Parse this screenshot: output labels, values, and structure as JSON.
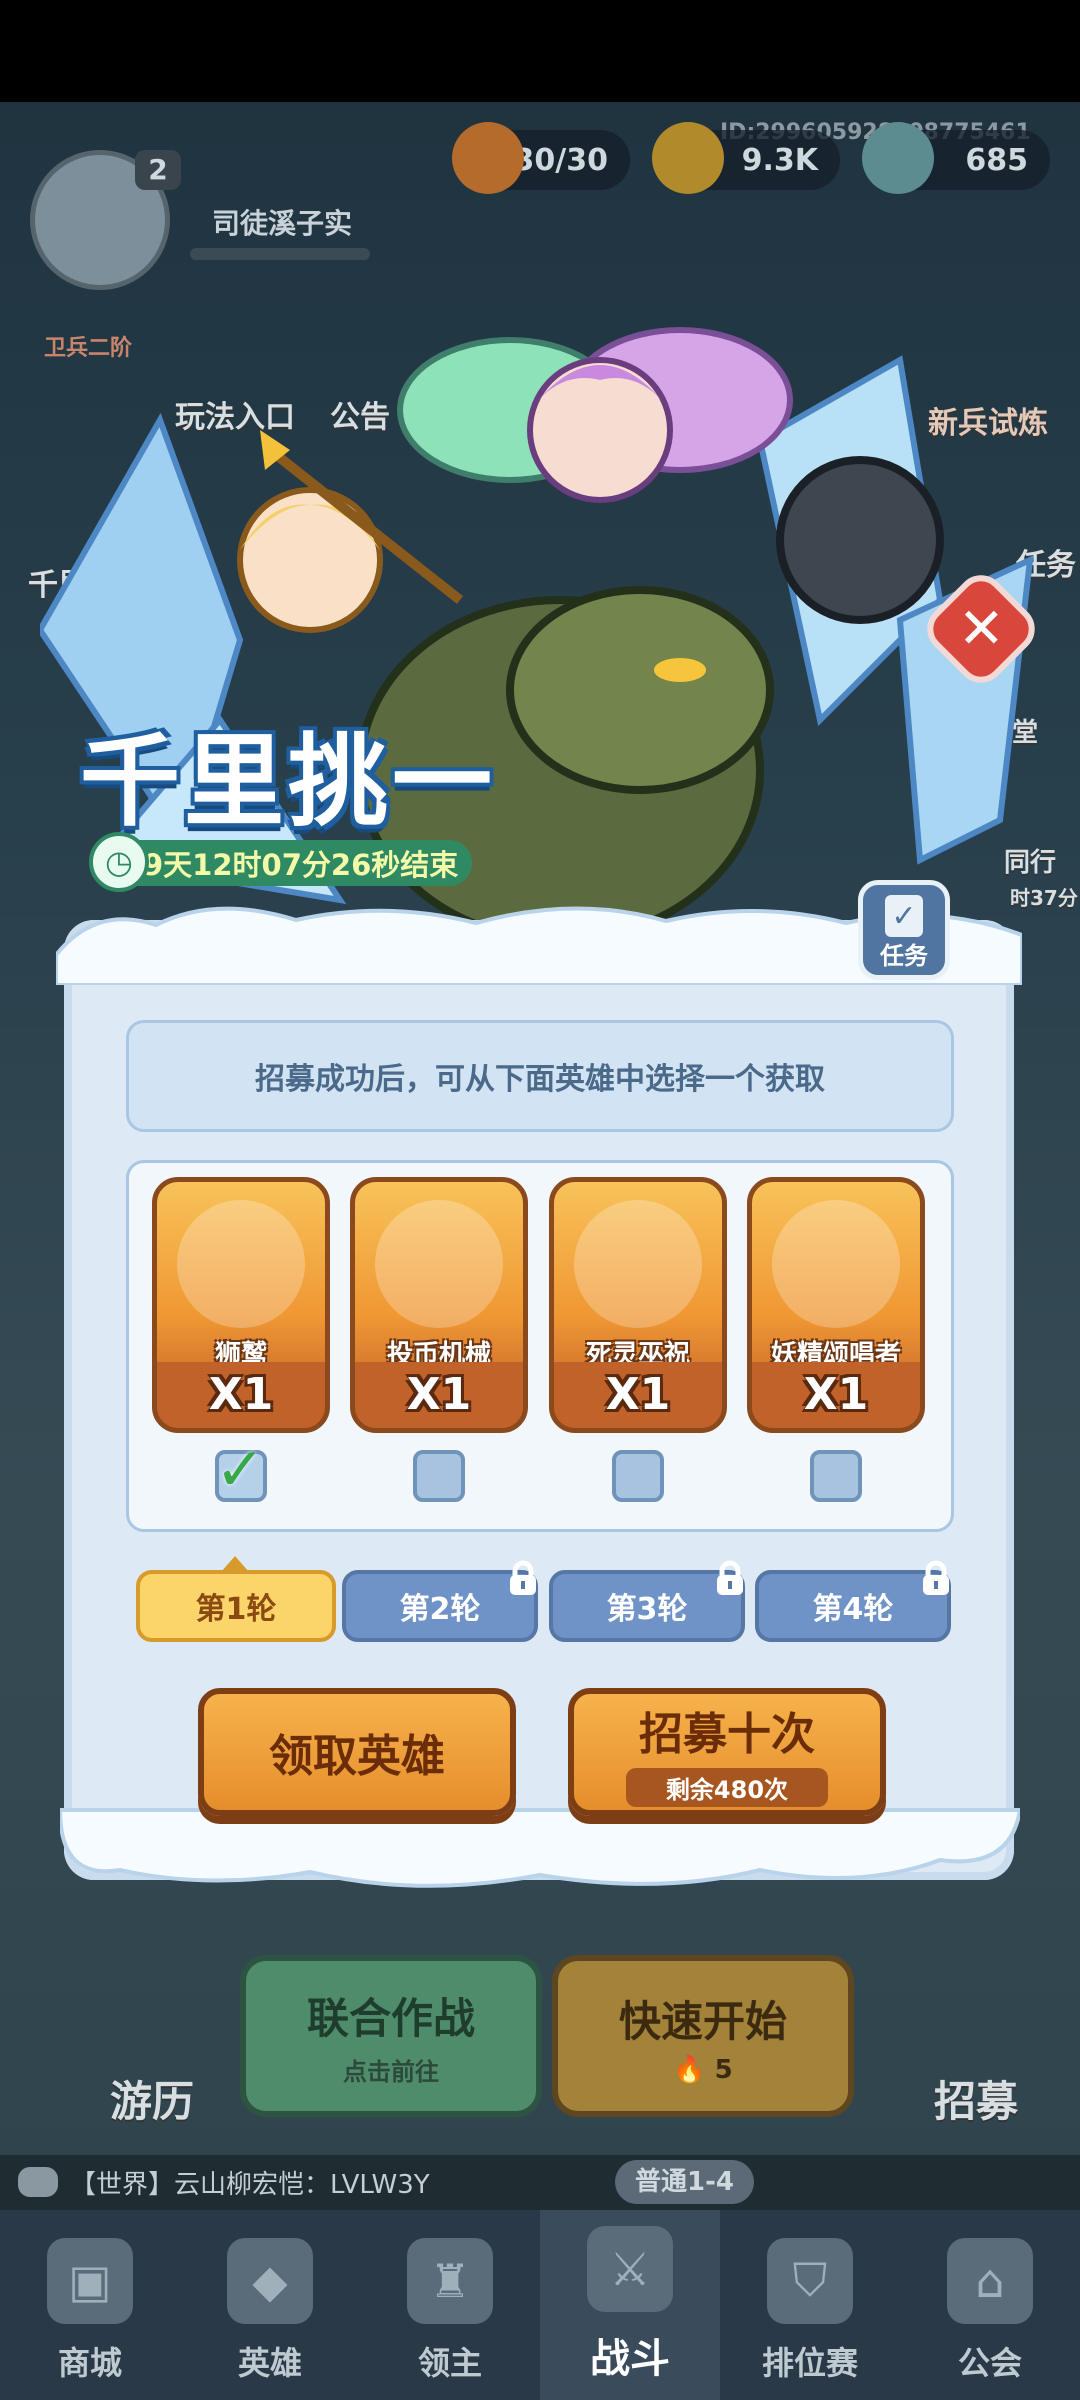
{
  "background": {
    "player_id": "ID:2996059288087754​61",
    "player_level": "2",
    "player_name": "司徒溪子实",
    "rank_badge": "卫兵二阶",
    "resources": [
      {
        "name": "stamina",
        "value": "30/30",
        "icon": "flame-icon"
      },
      {
        "name": "coins",
        "value": "9.3K",
        "icon": "coin-icon"
      },
      {
        "name": "crystals",
        "value": "685",
        "icon": "crystal-icon"
      }
    ],
    "left_menu": [
      "玩法入口",
      "公告",
      "千里挑一"
    ],
    "right_menu": [
      "新兵试炼",
      "任务",
      "鹅课堂",
      "同行",
      "时37分"
    ],
    "side_buttons": {
      "travel": "游历",
      "recruit": "招募"
    },
    "battle_buttons": {
      "alliance": {
        "title": "联合作战",
        "sub": "点击前往"
      },
      "quick_start": {
        "title": "快速开始",
        "cost": "5"
      }
    },
    "world_chat": "【世界】云山柳宏恺：LVLW3Y",
    "stage_label": "普通1-4",
    "bottom_nav": [
      {
        "label": "商城",
        "icon": "shop-icon"
      },
      {
        "label": "英雄",
        "icon": "hero-card-icon"
      },
      {
        "label": "领主",
        "icon": "castle-icon"
      },
      {
        "label": "战斗",
        "icon": "swords-icon",
        "active": true
      },
      {
        "label": "排位赛",
        "icon": "shield-rank-icon"
      },
      {
        "label": "公会",
        "icon": "guild-icon"
      }
    ]
  },
  "popup": {
    "title": "千里挑一",
    "timer": "9天12时07分26秒结束",
    "task_label": "任务",
    "notice": "招募成功后，可从下面英雄中选择一个获取",
    "heroes": [
      {
        "name": "狮鹫",
        "qty": "X1",
        "checked": true
      },
      {
        "name": "投币机械",
        "qty": "X1",
        "checked": false
      },
      {
        "name": "死灵巫祝",
        "qty": "X1",
        "checked": false
      },
      {
        "name": "妖精颂唱者",
        "qty": "X1",
        "checked": false
      }
    ],
    "rounds": [
      {
        "label": "第1轮",
        "locked": false,
        "active": true
      },
      {
        "label": "第2轮",
        "locked": true
      },
      {
        "label": "第3轮",
        "locked": true
      },
      {
        "label": "第4轮",
        "locked": true
      }
    ],
    "claim_button": "领取英雄",
    "recruit_button": {
      "label": "招募十次",
      "remaining": "剩余480次"
    }
  },
  "colors": {
    "panel_bg": "#dde9f4",
    "title_outline": "#1f5fa0",
    "button_orange": "#e58e2c",
    "tab_active": "#fbd46a",
    "tab_locked": "#6f93c6",
    "close_red": "#d9473c"
  }
}
